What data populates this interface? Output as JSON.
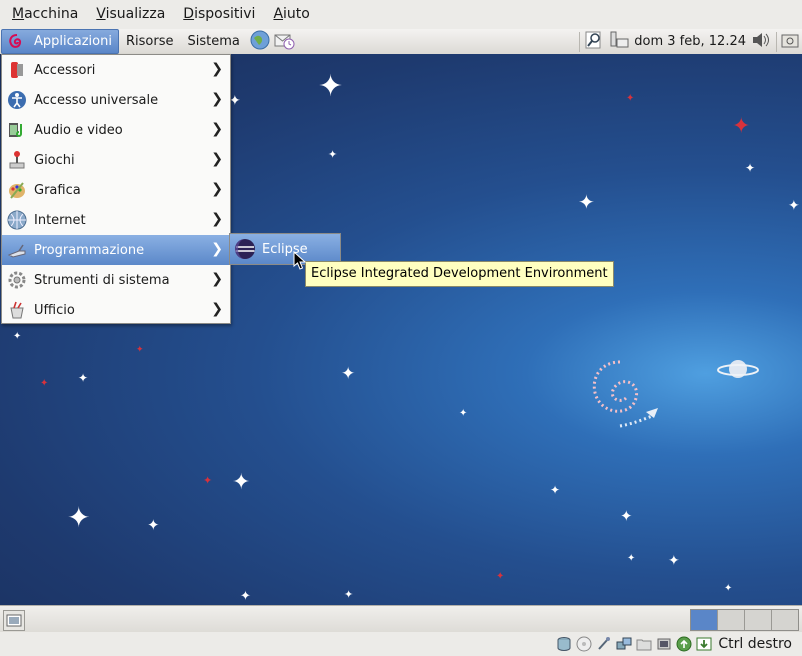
{
  "host_menu": [
    {
      "label": "Macchina",
      "underline": "M",
      "rest": "acchina"
    },
    {
      "label": "Visualizza",
      "underline": "V",
      "rest": "isualizza"
    },
    {
      "label": "Dispositivi",
      "underline": "D",
      "rest": "ispositivi"
    },
    {
      "label": "Aiuto",
      "underline": "A",
      "rest": "iuto"
    }
  ],
  "panel": {
    "applications": "Applicazioni",
    "places": "Risorse",
    "system": "Sistema",
    "clock": "dom  3 feb, 12.24"
  },
  "app_menu": {
    "items": [
      {
        "label": "Accessori",
        "icon": "accessories-icon"
      },
      {
        "label": "Accesso universale",
        "icon": "universal-access-icon"
      },
      {
        "label": "Audio e video",
        "icon": "audio-video-icon"
      },
      {
        "label": "Giochi",
        "icon": "games-icon"
      },
      {
        "label": "Grafica",
        "icon": "graphics-icon"
      },
      {
        "label": "Internet",
        "icon": "internet-icon"
      },
      {
        "label": "Programmazione",
        "icon": "programming-icon",
        "active": true
      },
      {
        "label": "Strumenti di sistema",
        "icon": "system-tools-icon"
      },
      {
        "label": "Ufficio",
        "icon": "office-icon"
      }
    ]
  },
  "submenu": {
    "items": [
      {
        "label": "Eclipse",
        "icon": "eclipse-icon"
      }
    ]
  },
  "tooltip": "Eclipse Integrated Development Environment",
  "statusbar": {
    "host_key": "Ctrl destro"
  },
  "colors": {
    "accent": "#5a86c8",
    "desktop_dark": "#1a2f5c",
    "desktop_glow": "#4f9fe0",
    "tooltip_bg": "#ffffc0"
  }
}
